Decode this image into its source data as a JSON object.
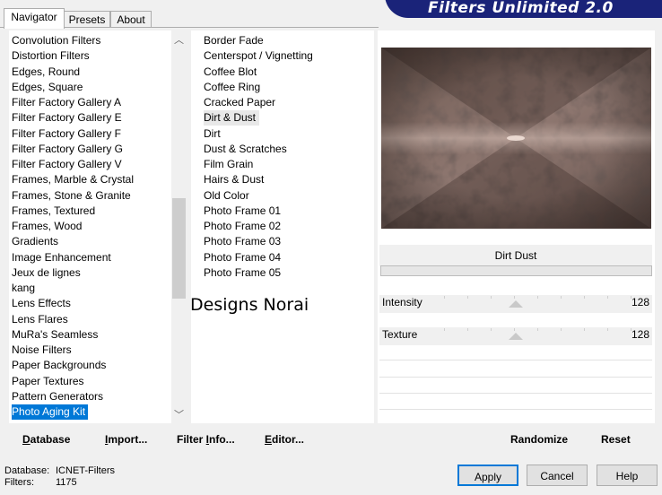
{
  "banner": {
    "title": "Filters Unlimited 2.0"
  },
  "tabs": [
    {
      "label": "Navigator",
      "active": true
    },
    {
      "label": "Presets",
      "active": false
    },
    {
      "label": "About",
      "active": false
    }
  ],
  "categories": [
    "Convolution Filters",
    "Distortion Filters",
    "Edges, Round",
    "Edges, Square",
    "Filter Factory Gallery A",
    "Filter Factory Gallery E",
    "Filter Factory Gallery F",
    "Filter Factory Gallery G",
    "Filter Factory Gallery V",
    "Frames, Marble & Crystal",
    "Frames, Stone & Granite",
    "Frames, Textured",
    "Frames, Wood",
    "Gradients",
    "Image Enhancement",
    "Jeux de lignes",
    "kang",
    "Lens Effects",
    "Lens Flares",
    "MuRa's Seamless",
    "Noise Filters",
    "Paper Backgrounds",
    "Paper Textures",
    "Pattern Generators",
    "Photo Aging Kit"
  ],
  "selected_category": "Photo Aging Kit",
  "filters": [
    "Border Fade",
    "Centerspot / Vignetting",
    "Coffee Blot",
    "Coffee Ring",
    "Cracked Paper",
    "Dirt & Dust",
    "Dirt",
    "Dust & Scratches",
    "Film Grain",
    "Hairs & Dust",
    "Old Color",
    "Photo Frame 01",
    "Photo Frame 02",
    "Photo Frame 03",
    "Photo Frame 04",
    "Photo Frame 05"
  ],
  "selected_filter": "Dirt & Dust",
  "watermark": "Designs Norai",
  "filter_header": "Dirt  Dust",
  "params": [
    {
      "label": "Intensity",
      "value": "128",
      "fraction": 0.5
    },
    {
      "label": "Texture",
      "value": "128",
      "fraction": 0.5
    }
  ],
  "toolbar": {
    "database": {
      "mnemonic": "D",
      "rest": "atabase"
    },
    "import": {
      "mnemonic": "I",
      "rest": "mport..."
    },
    "filter_info": {
      "prefix": "Filter ",
      "mnemonic": "I",
      "rest": "nfo..."
    },
    "editor": {
      "mnemonic": "E",
      "rest": "ditor..."
    },
    "randomize": "Randomize",
    "reset": "Reset"
  },
  "status": {
    "database_label": "Database:",
    "database_value": "ICNET-Filters",
    "filters_label": "Filters:",
    "filters_value": "1175"
  },
  "buttons": {
    "apply": "Apply",
    "cancel": "Cancel",
    "help": "Help"
  },
  "colors": {
    "banner": "#1a2379",
    "selection": "#0078d7"
  }
}
